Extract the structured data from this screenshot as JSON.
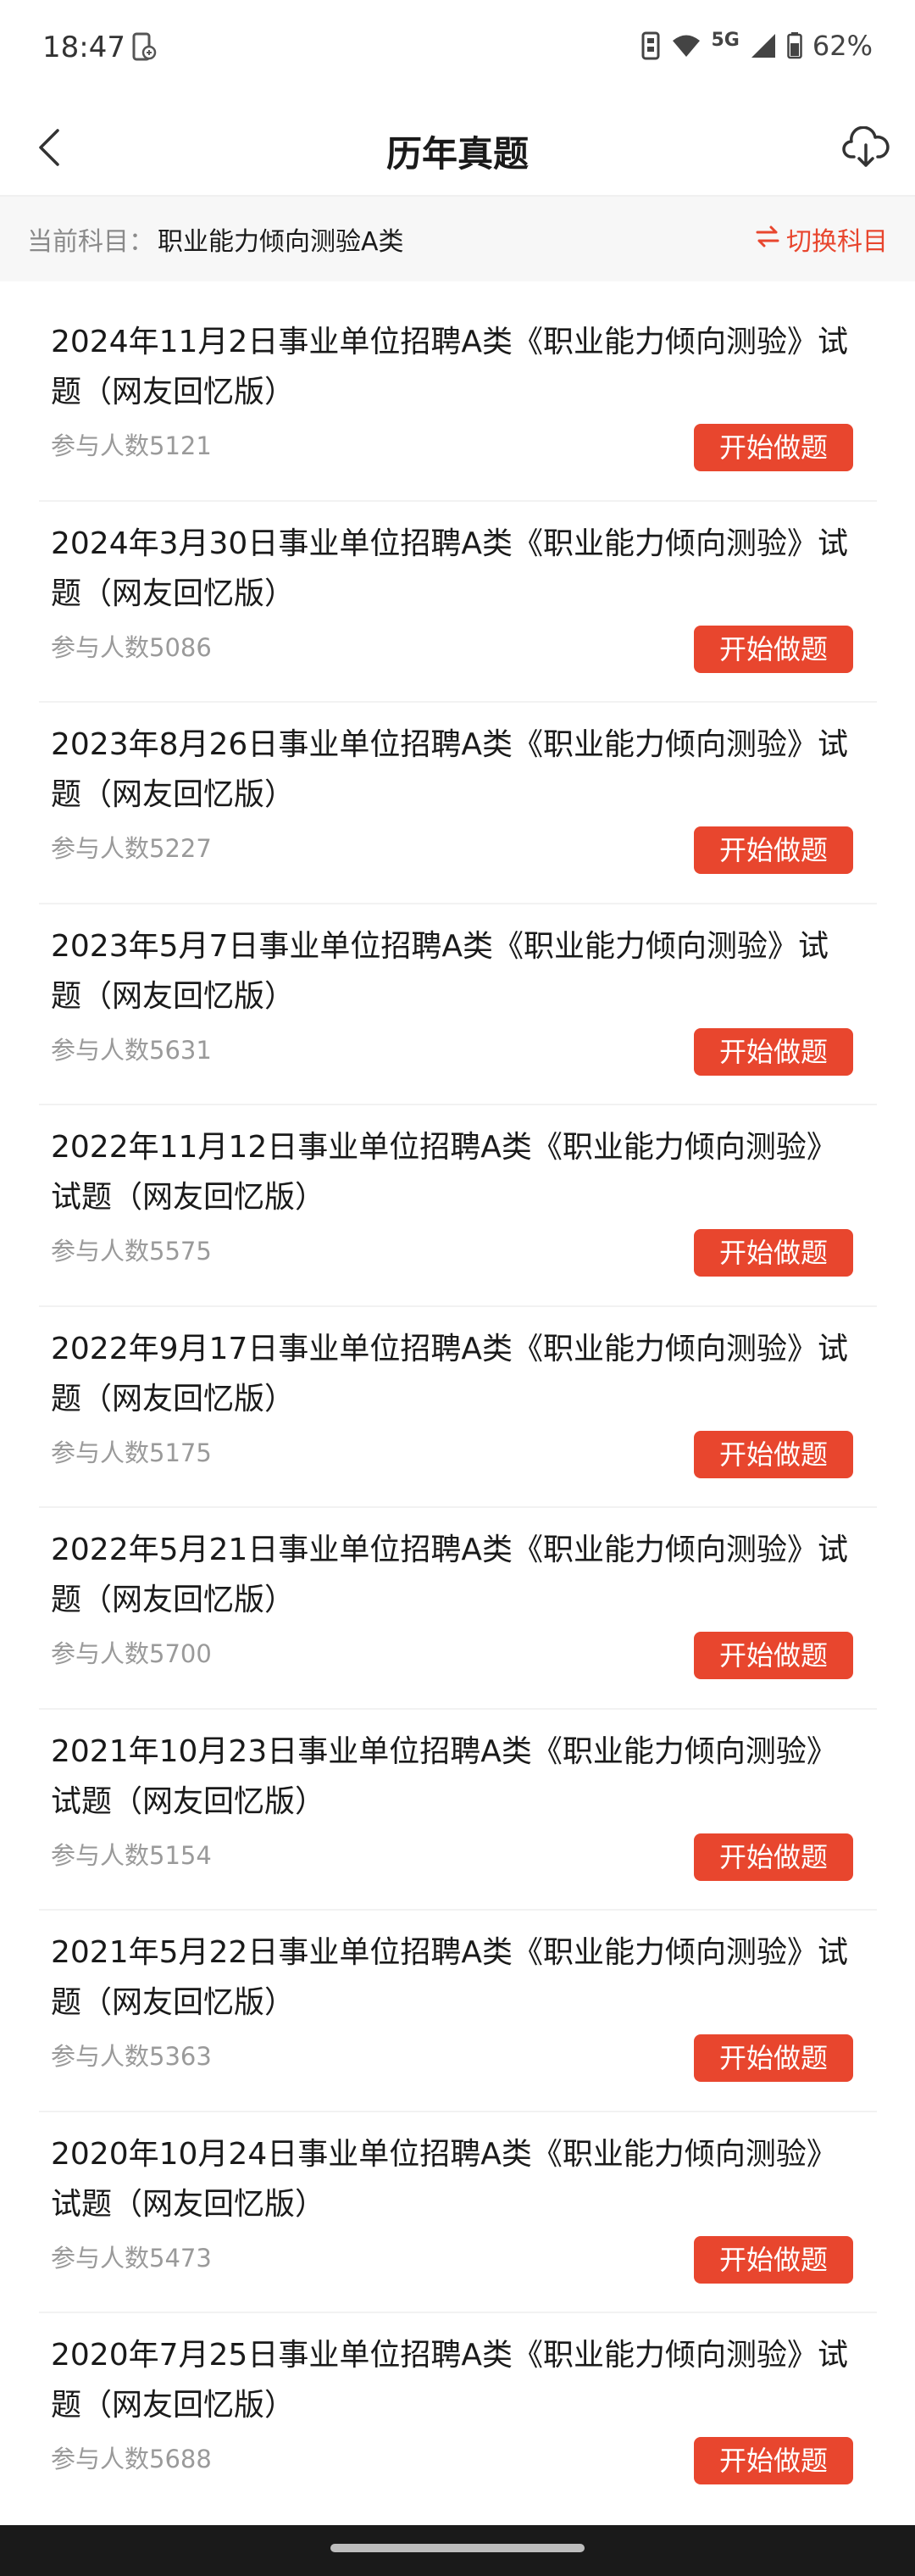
{
  "status_bar": {
    "time": "18:47",
    "network": "5G",
    "battery": "62%"
  },
  "nav": {
    "title": "历年真题"
  },
  "subject": {
    "label": "当前科目：",
    "value": "职业能力倾向测验A类",
    "switch_label": "切换科目"
  },
  "exams": [
    {
      "title": "2024年11月2日事业单位招聘A类《职业能力倾向测验》试题（网友回忆版）",
      "participants": "参与人数5121",
      "button": "开始做题"
    },
    {
      "title": "2024年3月30日事业单位招聘A类《职业能力倾向测验》试题（网友回忆版）",
      "participants": "参与人数5086",
      "button": "开始做题"
    },
    {
      "title": "2023年8月26日事业单位招聘A类《职业能力倾向测验》试题（网友回忆版）",
      "participants": "参与人数5227",
      "button": "开始做题"
    },
    {
      "title": "2023年5月7日事业单位招聘A类《职业能力倾向测验》试题（网友回忆版）",
      "participants": "参与人数5631",
      "button": "开始做题"
    },
    {
      "title": "2022年11月12日事业单位招聘A类《职业能力倾向测验》试题（网友回忆版）",
      "participants": "参与人数5575",
      "button": "开始做题"
    },
    {
      "title": "2022年9月17日事业单位招聘A类《职业能力倾向测验》试题（网友回忆版）",
      "participants": "参与人数5175",
      "button": "开始做题"
    },
    {
      "title": "2022年5月21日事业单位招聘A类《职业能力倾向测验》试题（网友回忆版）",
      "participants": "参与人数5700",
      "button": "开始做题"
    },
    {
      "title": "2021年10月23日事业单位招聘A类《职业能力倾向测验》试题（网友回忆版）",
      "participants": "参与人数5154",
      "button": "开始做题"
    },
    {
      "title": "2021年5月22日事业单位招聘A类《职业能力倾向测验》试题（网友回忆版）",
      "participants": "参与人数5363",
      "button": "开始做题"
    },
    {
      "title": "2020年10月24日事业单位招聘A类《职业能力倾向测验》试题（网友回忆版）",
      "participants": "参与人数5473",
      "button": "开始做题"
    },
    {
      "title": "2020年7月25日事业单位招聘A类《职业能力倾向测验》试题（网友回忆版）",
      "participants": "参与人数5688",
      "button": "开始做题"
    }
  ],
  "colors": {
    "accent": "#e8462e",
    "text_primary": "#1a1a1a",
    "text_secondary": "#9a9a9a"
  },
  "icons": {
    "back": "chevron-left-icon",
    "download": "cloud-download-icon",
    "switch": "swap-arrows-icon"
  }
}
